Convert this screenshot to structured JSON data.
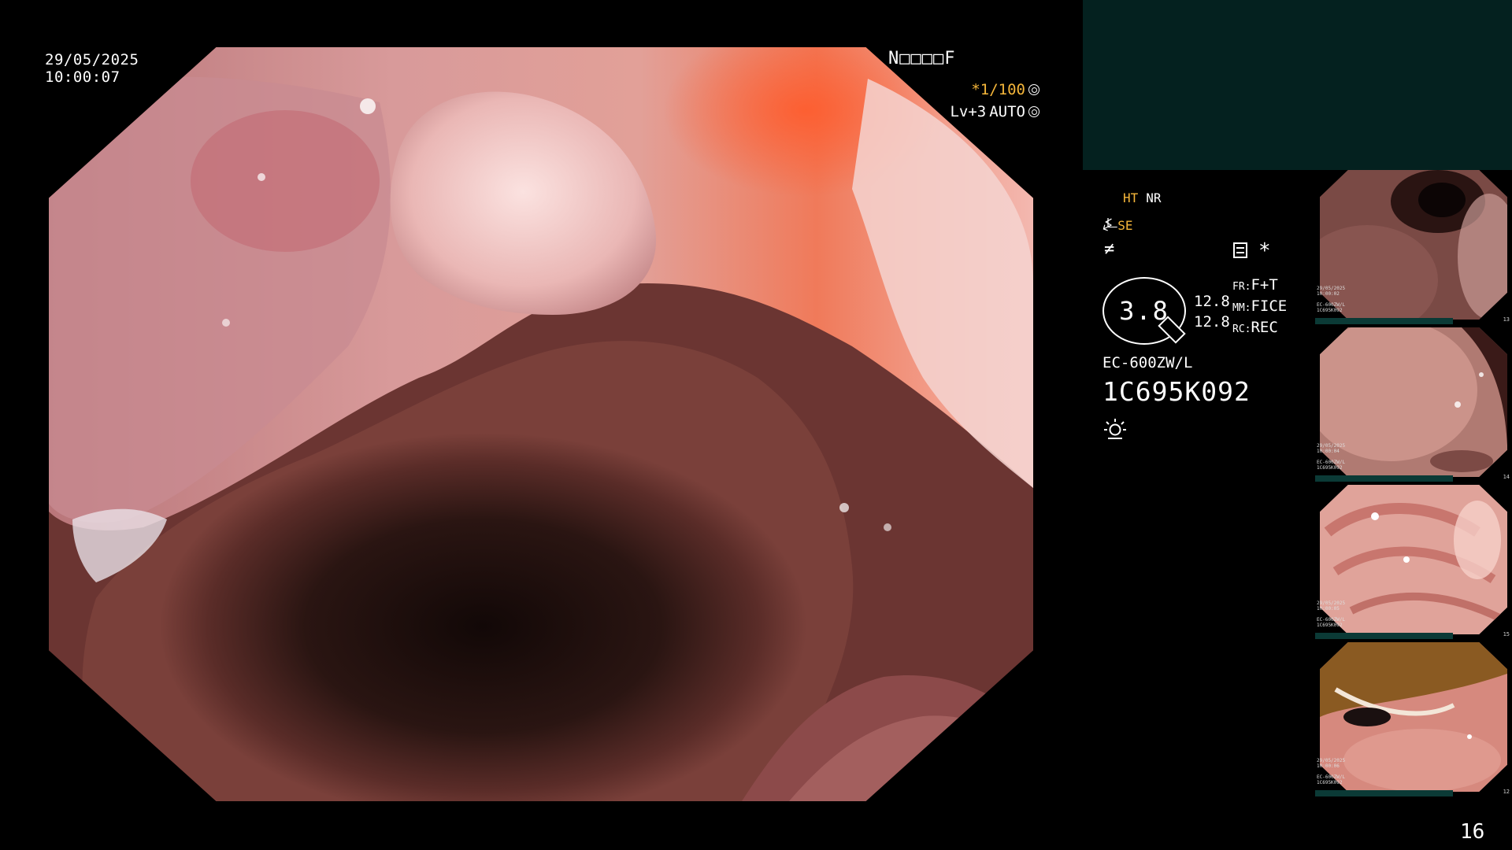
{
  "overlay": {
    "date": "29/05/2025",
    "time": "10:00:07",
    "status_code": "N□□□□F",
    "shutter": "*1/100",
    "level": "Lv+3",
    "auto_label": "AUTO"
  },
  "panel": {
    "mode_ht": "HT",
    "mode_nr": "NR",
    "mode_se": "SE",
    "se_prefix_glyph": "⍼",
    "f_glyph": "≠",
    "asterisk": "*",
    "zoom": "3.8",
    "nums": [
      "12.8",
      "12.8"
    ],
    "params": [
      {
        "key": "FR:",
        "value": "F+T"
      },
      {
        "key": "MM:",
        "value": "FICE"
      },
      {
        "key": "RC:",
        "value": "REC"
      }
    ],
    "scope_model": "EC-600ZW/L",
    "serial": "1C695K092"
  },
  "thumbnails": [
    {
      "index": "13",
      "caption": "29/05/2025\n10:00:02\n\nEC-600ZW/L\n1C695K092"
    },
    {
      "index": "14",
      "caption": "29/05/2025\n10:00:04\n\nEC-600ZW/L\n1C695K092"
    },
    {
      "index": "15",
      "caption": "29/05/2025\n10:00:05\n\nEC-600ZW/L\n1C695K092"
    },
    {
      "index": "12",
      "caption": "29/05/2025\n10:00:06\n\nEC-600ZW/L\n1C695K092"
    }
  ],
  "page_number": "16",
  "colors": {
    "background": "#000000",
    "accent_orange": "#f5b63a",
    "teal_box": "#04211f",
    "thumb_bar": "#0b3a36"
  }
}
